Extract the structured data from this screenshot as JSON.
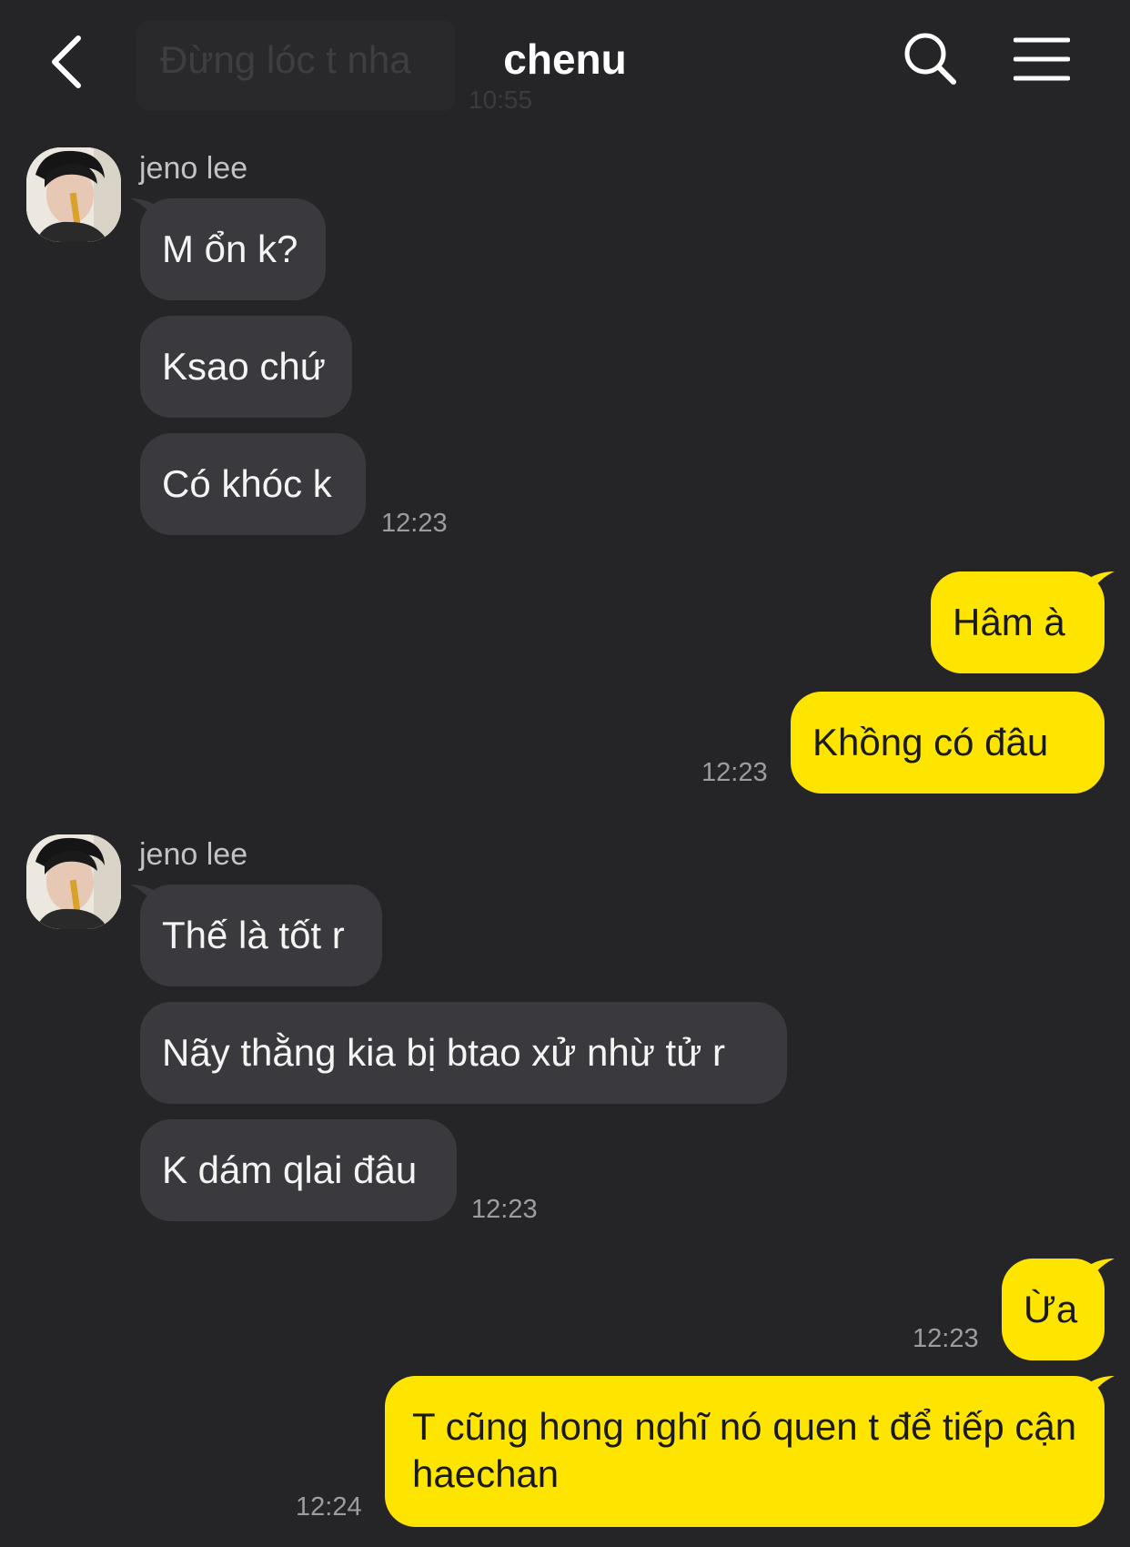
{
  "header": {
    "title": "chenu",
    "ghost_preview_text": "Đừng lóc t nha",
    "ghost_preview_time": "10:55"
  },
  "messages": [
    {
      "sender": "jeno lee",
      "lines": [
        "M ổn k?",
        "Ksao chứ",
        "Có khóc k"
      ],
      "time": "12:23"
    },
    {
      "sender": "me",
      "lines": [
        "Hâm à",
        "Khồng có đâu"
      ],
      "time": "12:23"
    },
    {
      "sender": "jeno lee",
      "lines": [
        "Thế là tốt r",
        "Nãy thằng kia bị btao xử nhừ tử r",
        "K dám qlai đâu"
      ],
      "time": "12:23"
    },
    {
      "sender": "me",
      "lines": [
        "Ừa"
      ],
      "time": "12:23"
    },
    {
      "sender": "me",
      "lines": [
        "T cũng hong nghĩ nó quen t để tiếp cận haechan"
      ],
      "time": "12:24"
    }
  ],
  "colors": {
    "background": "#252528",
    "incoming_bubble": "#3a3a3e",
    "outgoing_bubble": "#fee500"
  },
  "icons": [
    "back-arrow-icon",
    "search-icon",
    "menu-icon",
    "avatar-photo"
  ]
}
